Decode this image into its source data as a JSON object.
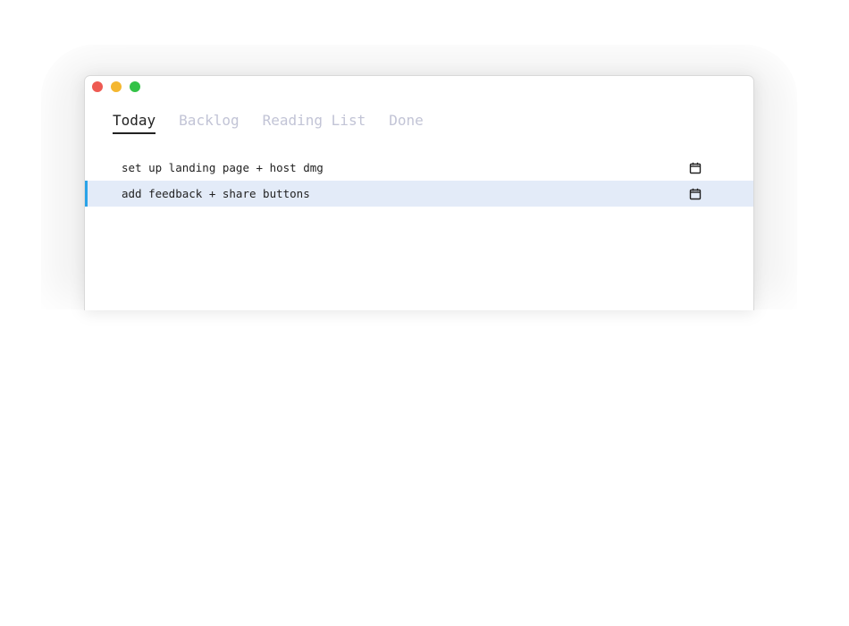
{
  "window": {
    "traffic_lights": {
      "close": "#ee5a52",
      "minimize": "#f4b730",
      "zoom": "#33c247"
    }
  },
  "tabs": [
    {
      "label": "Today",
      "active": true
    },
    {
      "label": "Backlog",
      "active": false
    },
    {
      "label": "Reading List",
      "active": false
    },
    {
      "label": "Done",
      "active": false
    }
  ],
  "tasks": [
    {
      "text": "set up landing page + host dmg",
      "icon": "calendar-icon",
      "selected": false
    },
    {
      "text": "add feedback + share buttons",
      "icon": "calendar-icon",
      "selected": true
    }
  ],
  "colors": {
    "selection_bg": "#e3ebf8",
    "selection_accent": "#2aa3e8",
    "inactive_tab": "#c2c4d6",
    "active_tab": "#222222"
  }
}
